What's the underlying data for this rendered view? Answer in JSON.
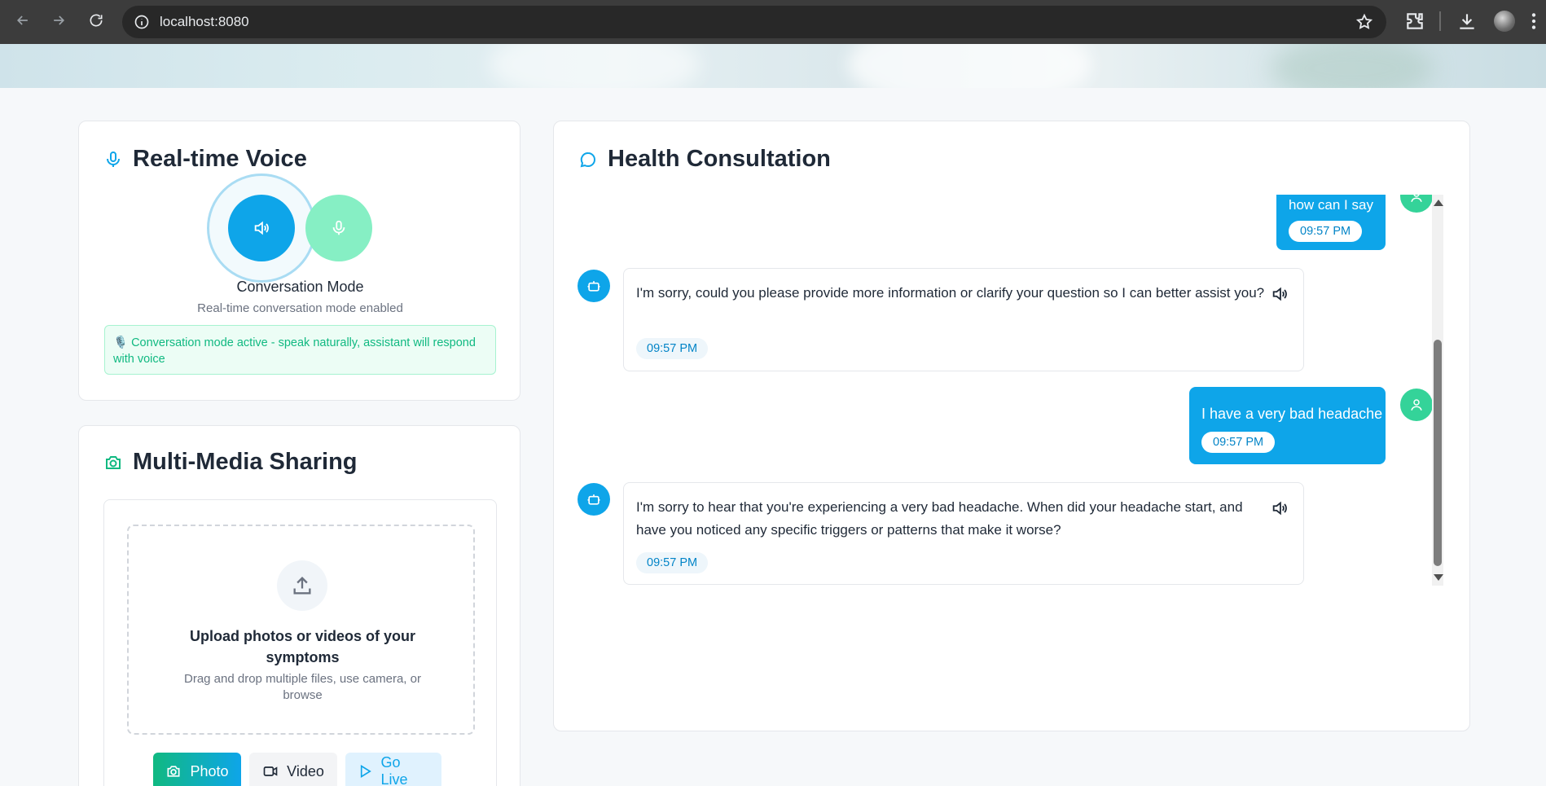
{
  "browser": {
    "url": "localhost:8080"
  },
  "voice": {
    "title": "Real-time Voice",
    "mode_title": "Conversation Mode",
    "mode_subtitle": "Real-time conversation mode enabled",
    "status_message": "🎙️ Conversation mode active - speak naturally, assistant will respond with voice"
  },
  "media": {
    "title": "Multi-Media Sharing",
    "upload_title": "Upload photos or videos of your symptoms",
    "upload_subtitle": "Drag and drop multiple files, use camera, or browse",
    "buttons": {
      "photo": "Photo",
      "video": "Video",
      "live": "Go Live"
    }
  },
  "chat": {
    "title": "Health Consultation",
    "messages": [
      {
        "role": "user",
        "text": "how can I say",
        "time": "09:57 PM"
      },
      {
        "role": "assistant",
        "text": "I'm sorry, could you please provide more information or clarify your question so I can better assist you?",
        "time": "09:57 PM"
      },
      {
        "role": "user",
        "text": "I have a very bad headache",
        "time": "09:57 PM"
      },
      {
        "role": "assistant",
        "text": "I'm sorry to hear that you're experiencing a very bad headache. When did your headache start, and have you noticed any specific triggers or patterns that make it worse?",
        "time": "09:57 PM"
      }
    ]
  },
  "colors": {
    "primary": "#0ea5e9",
    "success": "#10b981",
    "user_avatar": "#34d399"
  }
}
